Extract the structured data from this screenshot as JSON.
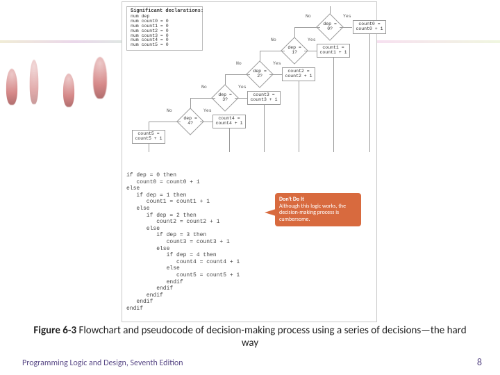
{
  "decl": {
    "header": "Significant declarations:",
    "lines": "num dep\nnum count0 = 0\nnum count1 = 0\nnum count2 = 0\nnum count3 = 0\nnum count4 = 0\nnum count5 = 0"
  },
  "flow": {
    "dec0": "dep = 0?",
    "dec1": "dep = 1?",
    "dec2": "dep = 2?",
    "dec3": "dep = 3?",
    "dec4": "dep = 4?",
    "act0": "count0 =\ncount0 + 1",
    "act1": "count1 =\ncount1 + 1",
    "act2": "count2 =\ncount2 + 1",
    "act3": "count3 =\ncount3 + 1",
    "act4": "count4 =\ncount4 + 1",
    "act5": "count5 =\ncount5 + 1",
    "yes": "Yes",
    "no": "No"
  },
  "pseudocode": "if dep = 0 then\n   count0 = count0 + 1\nelse\n   if dep = 1 then\n      count1 = count1 + 1\n   else\n      if dep = 2 then\n         count2 = count2 + 1\n      else\n         if dep = 3 then\n            count3 = count3 + 1\n         else\n            if dep = 4 then\n               count4 = count4 + 1\n            else\n               count5 = count5 + 1\n            endif\n         endif\n      endif\n   endif\nendif",
  "callout": {
    "title": "Don't Do It",
    "body": "Although this logic works, the decision-making process is cumbersome."
  },
  "caption_label": "Figure 6-3",
  "caption_text": "Flowchart and pseudocode of decision-making process using a series of decisions—the hard way",
  "footer_left": "Programming Logic and Design, Seventh Edition",
  "footer_right": "8"
}
